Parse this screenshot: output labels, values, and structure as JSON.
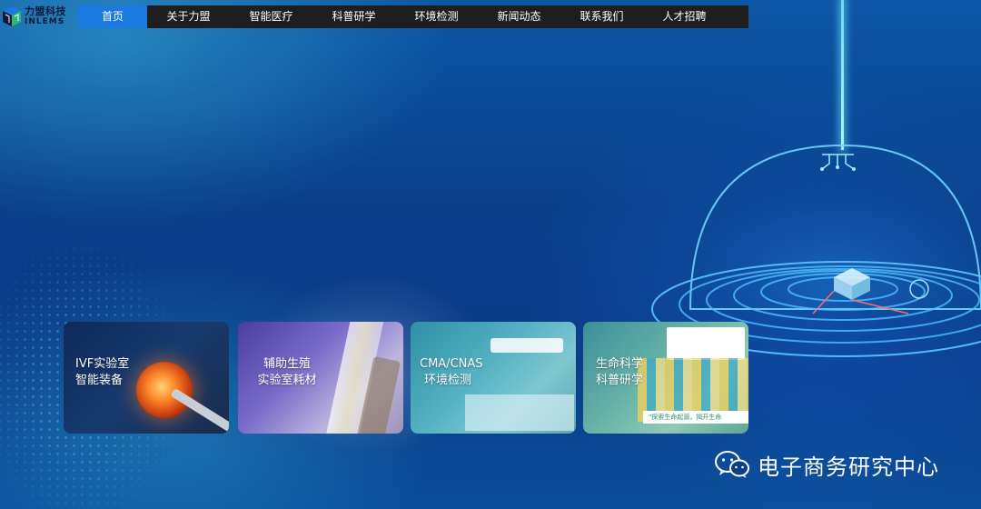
{
  "logo": {
    "name_cn": "力盟科技",
    "name_en": "INLEMS"
  },
  "nav": {
    "items": [
      {
        "label": "首页",
        "active": true
      },
      {
        "label": "关于力盟",
        "active": false
      },
      {
        "label": "智能医疗",
        "active": false
      },
      {
        "label": "科普研学",
        "active": false
      },
      {
        "label": "环境检测",
        "active": false
      },
      {
        "label": "新闻动态",
        "active": false
      },
      {
        "label": "联系我们",
        "active": false
      },
      {
        "label": "人才招聘",
        "active": false
      }
    ]
  },
  "cards": [
    {
      "line1": "IVF实验室",
      "line2": "智能装备",
      "icon": "ivf-egg-image"
    },
    {
      "line1": "辅助生殖",
      "line2": "实验室耗材",
      "icon": "consumables-image"
    },
    {
      "line1": "CMA/CNAS",
      "line2": "环境检测",
      "icon": "lab-room-image"
    },
    {
      "line1": "生命科学",
      "line2": "科普研学",
      "icon": "students-image",
      "banner_text": "\"探索生命起源，揭开生命"
    }
  ],
  "watermark": {
    "text": "电子商务研究中心",
    "icon": "wechat-icon"
  },
  "colors": {
    "nav_bg": "#1e1e1e",
    "nav_active": "#1a7ae0",
    "background": "#0a3f88",
    "beam": "#8fe9ff"
  }
}
